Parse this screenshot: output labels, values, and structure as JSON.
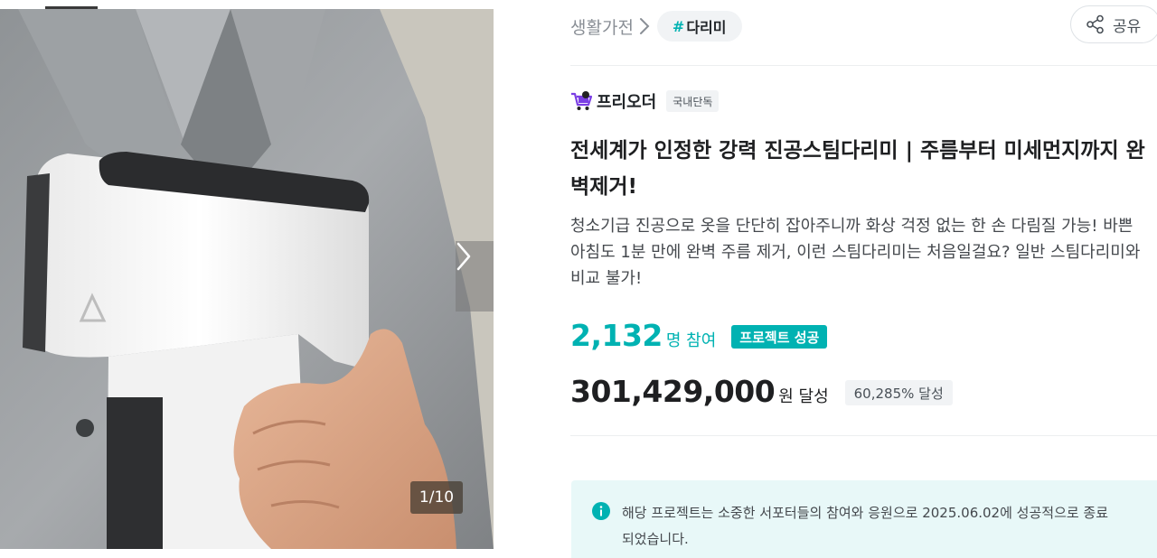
{
  "gallery": {
    "counter": "1/10",
    "next_icon": "chevron-right-icon"
  },
  "breadcrumb": {
    "category": "생활가전",
    "tag_hash": "#",
    "tag_label": "다리미"
  },
  "share": {
    "label": "공유",
    "icon": "share-icon"
  },
  "maker": {
    "name": "프리오더",
    "badge": "국내단독",
    "icon": "cart-icon"
  },
  "project": {
    "title": "전세계가 인정한 강력 진공스팀다리미 | 주름부터 미세먼지까지 완벽제거!",
    "description": "청소기급 진공으로 옷을 단단히 잡아주니까 화상 걱정 없는 한 손 다림질 가능! 바쁜 아침도 1분 만에 완벽 주름 제거, 이런 스팀다리미는 처음일걸요? 일반 스팀다리미와 비교 불가!"
  },
  "stats": {
    "supporters": "2,132",
    "supporters_unit": "명 참여",
    "status": "프로젝트 성공",
    "amount": "301,429,000",
    "amount_unit": "원 달성",
    "percent": "60,285% 달성"
  },
  "notice": {
    "text": "해당 프로젝트는 소중한 서포터들의 참여와 응원으로 2025.06.02에 성공적으로 종료되었습니다.",
    "icon": "info-icon"
  },
  "colors": {
    "accent": "#00b2b2",
    "notice_bg": "#e8f8f8",
    "chip_bg": "#f1f3f5"
  }
}
